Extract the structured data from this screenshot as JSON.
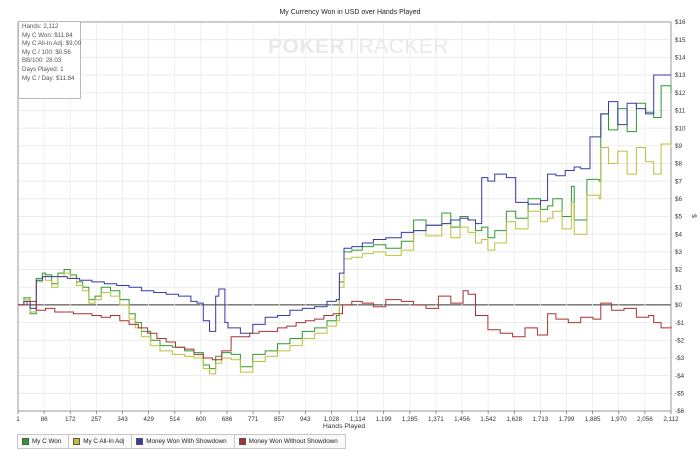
{
  "chart_data": {
    "type": "line",
    "title": "My Currency Won in USD over Hands Played",
    "xlabel": "Hands Played",
    "ylabel": "$",
    "xlim": [
      1,
      2112
    ],
    "ylim": [
      -6,
      16
    ],
    "x_ticks": [
      "1",
      "86",
      "172",
      "257",
      "343",
      "429",
      "514",
      "600",
      "686",
      "771",
      "857",
      "943",
      "1,028",
      "1,114",
      "1,199",
      "1,285",
      "1,371",
      "1,456",
      "1,542",
      "1,628",
      "1,713",
      "1,799",
      "1,885",
      "1,970",
      "2,056",
      "2,112"
    ],
    "y_ticks": [
      "$16",
      "$15",
      "$14",
      "$13",
      "$12",
      "$11",
      "$10",
      "$9",
      "$8",
      "$7",
      "$6",
      "$5",
      "$4",
      "$3",
      "$2",
      "$1",
      "$0",
      "-$1",
      "-$2",
      "-$3",
      "-$4",
      "-$5",
      "-$6"
    ],
    "y_tick_values": [
      16,
      15,
      14,
      13,
      12,
      11,
      10,
      9,
      8,
      7,
      6,
      5,
      4,
      3,
      2,
      1,
      0,
      -1,
      -2,
      -3,
      -4,
      -5,
      -6
    ],
    "grid": true,
    "legend_position": "bottom-left",
    "series": [
      {
        "name": "My C Won",
        "color": "#2e9a2e",
        "x": [
          1,
          20,
          40,
          60,
          80,
          90,
          110,
          130,
          150,
          170,
          190,
          210,
          230,
          250,
          270,
          300,
          330,
          360,
          380,
          400,
          430,
          460,
          500,
          540,
          570,
          600,
          620,
          640,
          660,
          690,
          720,
          760,
          800,
          840,
          880,
          920,
          960,
          1000,
          1030,
          1040,
          1055,
          1080,
          1114,
          1150,
          1190,
          1240,
          1280,
          1320,
          1371,
          1400,
          1430,
          1456,
          1480,
          1500,
          1520,
          1542,
          1580,
          1610,
          1650,
          1690,
          1713,
          1730,
          1760,
          1790,
          1799,
          1840,
          1880,
          1885,
          1910,
          1940,
          1970,
          2000,
          2030,
          2056,
          2080,
          2112
        ],
        "y": [
          0,
          0.4,
          -0.5,
          1.5,
          1.8,
          1.7,
          1.2,
          1.8,
          2.0,
          1.7,
          1.3,
          1.0,
          0.3,
          0.5,
          1.0,
          0.8,
          0.3,
          -0.5,
          -1.0,
          -1.5,
          -2.0,
          -2.3,
          -2.4,
          -2.6,
          -2.7,
          -3.4,
          -3.6,
          -2.9,
          -2.7,
          -2.8,
          -3.5,
          -2.8,
          -2.6,
          -2.2,
          -1.9,
          -1.5,
          -1.3,
          -0.9,
          -0.6,
          1.3,
          3.0,
          3.1,
          3.3,
          3.4,
          3.2,
          3.6,
          4.8,
          4.5,
          5.2,
          4.4,
          5.0,
          4.8,
          4.2,
          4.4,
          3.8,
          4.2,
          5.3,
          4.9,
          6.0,
          5.4,
          5.6,
          6.0,
          5.0,
          6.7,
          4.8,
          7.1,
          7.0,
          10.8,
          9.9,
          11.1,
          9.8,
          11.4,
          10.9,
          10.6,
          12.4,
          12.0
        ]
      },
      {
        "name": "My C All-In Adj",
        "color": "#b9c23a",
        "x": [
          1,
          20,
          40,
          60,
          80,
          90,
          110,
          130,
          150,
          170,
          190,
          210,
          230,
          250,
          270,
          300,
          330,
          360,
          380,
          400,
          430,
          460,
          500,
          540,
          570,
          600,
          620,
          640,
          660,
          690,
          720,
          760,
          800,
          840,
          880,
          920,
          960,
          1000,
          1030,
          1040,
          1055,
          1080,
          1114,
          1150,
          1190,
          1240,
          1280,
          1320,
          1371,
          1400,
          1430,
          1456,
          1480,
          1500,
          1520,
          1542,
          1580,
          1610,
          1650,
          1690,
          1713,
          1730,
          1760,
          1790,
          1799,
          1840,
          1880,
          1885,
          1910,
          1940,
          1970,
          2000,
          2030,
          2056,
          2080,
          2112
        ],
        "y": [
          0,
          0.3,
          -0.4,
          1.3,
          1.6,
          1.4,
          1.0,
          1.6,
          1.8,
          1.5,
          1.1,
          0.8,
          0.1,
          0.3,
          0.7,
          0.5,
          0.0,
          -0.8,
          -1.3,
          -1.8,
          -2.3,
          -2.6,
          -2.8,
          -2.9,
          -3.0,
          -3.6,
          -3.9,
          -3.3,
          -3.0,
          -3.1,
          -3.8,
          -3.2,
          -2.9,
          -2.6,
          -2.3,
          -1.9,
          -1.6,
          -1.2,
          -0.9,
          1.0,
          2.6,
          2.7,
          2.9,
          3.0,
          2.8,
          3.1,
          4.2,
          3.9,
          4.6,
          3.8,
          4.4,
          4.1,
          3.5,
          3.7,
          3.1,
          3.5,
          4.7,
          4.3,
          5.3,
          4.7,
          4.9,
          5.3,
          4.3,
          5.8,
          4.0,
          6.2,
          6.0,
          8.9,
          8.0,
          8.7,
          7.4,
          8.9,
          8.1,
          7.4,
          9.1,
          8.9
        ]
      },
      {
        "name": "Money Won With Showdown",
        "color": "#3838a8",
        "x": [
          1,
          20,
          40,
          60,
          80,
          120,
          160,
          200,
          240,
          280,
          320,
          360,
          400,
          440,
          480,
          520,
          560,
          580,
          600,
          620,
          640,
          650,
          670,
          680,
          700,
          720,
          760,
          800,
          840,
          880,
          920,
          960,
          1000,
          1030,
          1040,
          1055,
          1080,
          1114,
          1150,
          1190,
          1240,
          1280,
          1320,
          1371,
          1400,
          1430,
          1456,
          1480,
          1500,
          1520,
          1542,
          1580,
          1610,
          1650,
          1690,
          1713,
          1740,
          1770,
          1799,
          1820,
          1850,
          1885,
          1910,
          1940,
          1970,
          2000,
          2030,
          2056,
          2080,
          2112
        ],
        "y": [
          0,
          0.2,
          -0.2,
          1.4,
          1.6,
          1.6,
          1.5,
          1.4,
          1.3,
          1.2,
          1.1,
          1.0,
          0.8,
          0.7,
          0.6,
          0.5,
          0.2,
          0.1,
          -0.9,
          -1.5,
          0.5,
          0.9,
          -1.0,
          -1.3,
          -1.3,
          -1.6,
          -1.1,
          -0.7,
          -0.6,
          -0.3,
          -0.2,
          -0.1,
          0.2,
          0.3,
          1.8,
          3.2,
          3.3,
          3.5,
          3.7,
          3.8,
          4.1,
          4.2,
          4.5,
          4.6,
          4.8,
          4.9,
          4.8,
          4.6,
          7.2,
          7.0,
          7.4,
          7.2,
          5.8,
          5.7,
          5.9,
          7.4,
          7.3,
          7.6,
          7.8,
          7.7,
          9.5,
          10.8,
          11.5,
          10.2,
          11.4,
          11.1,
          10.8,
          13.0,
          13.0,
          13.0
        ]
      },
      {
        "name": "Money Won Without Showdown",
        "color": "#a83232",
        "x": [
          1,
          30,
          60,
          90,
          120,
          150,
          180,
          210,
          240,
          270,
          300,
          330,
          360,
          390,
          420,
          450,
          480,
          510,
          540,
          570,
          600,
          630,
          660,
          690,
          720,
          750,
          780,
          810,
          840,
          870,
          900,
          930,
          960,
          990,
          1020,
          1050,
          1080,
          1114,
          1150,
          1190,
          1240,
          1280,
          1320,
          1360,
          1400,
          1440,
          1456,
          1480,
          1520,
          1560,
          1600,
          1640,
          1680,
          1713,
          1740,
          1780,
          1820,
          1860,
          1885,
          1920,
          1960,
          2000,
          2040,
          2056,
          2080,
          2112
        ],
        "y": [
          0,
          0.2,
          -0.3,
          -0.2,
          -0.4,
          -0.4,
          -0.5,
          -0.5,
          -0.6,
          -0.7,
          -0.6,
          -0.9,
          -1.1,
          -1.3,
          -1.6,
          -1.9,
          -2.1,
          -2.4,
          -2.5,
          -2.8,
          -3.0,
          -3.1,
          -2.6,
          -1.8,
          -1.8,
          -1.6,
          -1.5,
          -1.5,
          -1.3,
          -1.2,
          -1.0,
          -0.9,
          -0.8,
          -0.6,
          -0.5,
          0.0,
          0.2,
          0.1,
          -0.1,
          0.3,
          0.2,
          0.0,
          -0.2,
          0.5,
          0.1,
          0.8,
          0.6,
          -0.6,
          -1.4,
          -1.6,
          -1.8,
          -1.3,
          -1.7,
          -0.5,
          -0.8,
          -1.0,
          -0.7,
          -0.8,
          0.1,
          -0.3,
          -0.2,
          -0.7,
          -0.6,
          -1.0,
          -1.3,
          -1.2
        ]
      }
    ]
  },
  "stats": {
    "hands": "Hands: 2,112",
    "won": "My C Won: $11.84",
    "allin": "My C All-In Adj: $9.00",
    "per100": "My C / 100: $0.56",
    "bb100": "BB/100: 28.03",
    "days": "Days Played: 1",
    "perday": "My C / Day: $11.84"
  },
  "watermark": {
    "bold": "POKER",
    "light": "TRACKER"
  },
  "legend": [
    {
      "label": "My C Won",
      "color": "#2e9a2e"
    },
    {
      "label": "My C All-In Adj",
      "color": "#b9c23a"
    },
    {
      "label": "Money Won With Showdown",
      "color": "#3838a8"
    },
    {
      "label": "Money Won Without Showdown",
      "color": "#a83232"
    }
  ]
}
